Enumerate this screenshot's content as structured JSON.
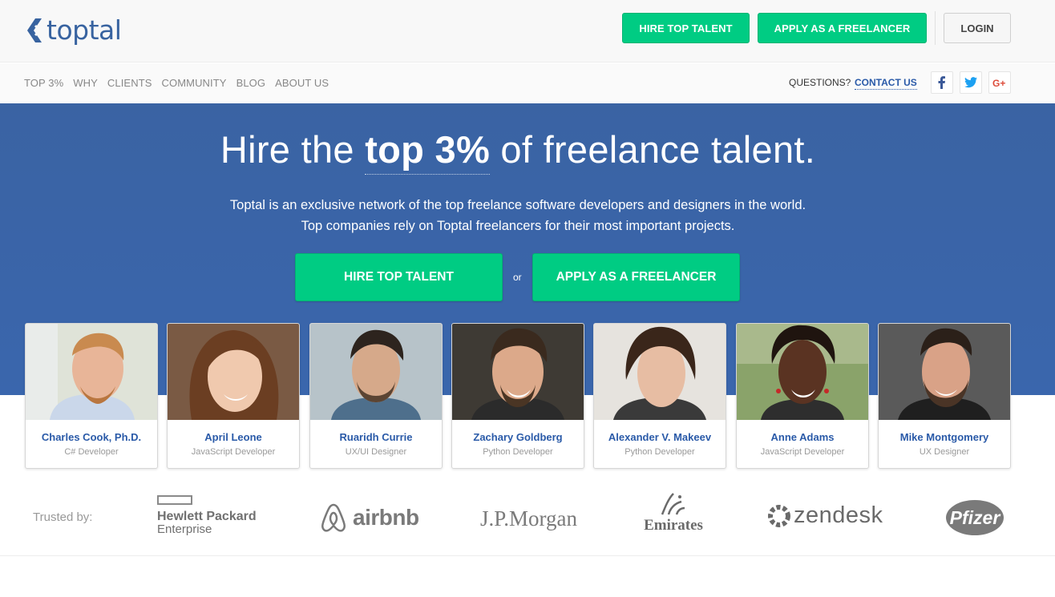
{
  "header": {
    "logo_text": "toptal",
    "hire_label": "HIRE TOP TALENT",
    "apply_label": "APPLY AS A FREELANCER",
    "login_label": "LOGIN"
  },
  "nav": {
    "items": [
      "TOP 3%",
      "WHY",
      "CLIENTS",
      "COMMUNITY",
      "BLOG",
      "ABOUT US"
    ],
    "questions": "QUESTIONS?",
    "contact": "CONTACT US",
    "social": [
      "facebook-icon",
      "twitter-icon",
      "google-plus-icon"
    ]
  },
  "hero": {
    "title_pre": "Hire the ",
    "title_emph": "top 3%",
    "title_post": " of freelance talent.",
    "sub1": "Toptal is an exclusive network of the top freelance software developers and designers in the world.",
    "sub2": "Top companies rely on Toptal freelancers for their most important projects.",
    "hire_label": "HIRE TOP TALENT",
    "or": "or",
    "apply_label": "APPLY AS A FREELANCER"
  },
  "freelancers": [
    {
      "name": "Charles Cook, Ph.D.",
      "role": "C# Developer"
    },
    {
      "name": "April Leone",
      "role": "JavaScript Developer"
    },
    {
      "name": "Ruaridh Currie",
      "role": "UX/UI Designer"
    },
    {
      "name": "Zachary Goldberg",
      "role": "Python Developer"
    },
    {
      "name": "Alexander V. Makeev",
      "role": "Python Developer"
    },
    {
      "name": "Anne Adams",
      "role": "JavaScript Developer"
    },
    {
      "name": "Mike Montgomery",
      "role": "UX Designer"
    }
  ],
  "trusted": {
    "label": "Trusted by:",
    "brands": [
      "Hewlett Packard",
      "Enterprise",
      "airbnb",
      "J.P.Morgan",
      "Emirates",
      "zendesk",
      "Pfizer"
    ]
  },
  "colors": {
    "brand_blue": "#3863a0",
    "accent_green": "#00cc83",
    "link_blue": "#2a5aa8"
  }
}
